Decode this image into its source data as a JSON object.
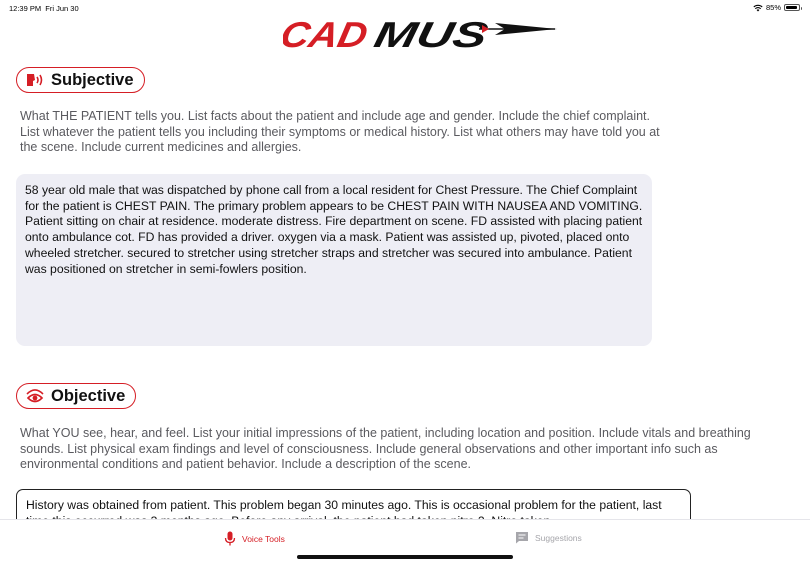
{
  "status_bar": {
    "time": "12:39 PM",
    "date": "Fri Jun 30",
    "battery": "85%"
  },
  "app": {
    "logo_text": "CADMUS"
  },
  "subjective": {
    "title": "Subjective",
    "instructions": "What THE PATIENT tells you. List facts about the patient and include age and gender. Include the chief complaint. List whatever the patient tells you including their symptoms or medical history. List what others may have told you at the scene. Include current medicines and allergies.",
    "narrative": "58 year old male that was dispatched by phone call from a local resident for Chest Pressure. The Chief Complaint for the patient is CHEST PAIN. The primary problem appears to be CHEST PAIN WITH NAUSEA AND VOMITING. Patient sitting on chair at residence. moderate distress. Fire department on scene. FD assisted with placing patient onto ambulance cot. FD has provided a driver. oxygen via a mask. Patient was assisted up, pivoted, placed onto wheeled stretcher. secured to stretcher using stretcher straps and stretcher was secured into ambulance. Patient was positioned on stretcher in semi-fowlers position."
  },
  "objective": {
    "title": "Objective",
    "instructions": "What YOU see, hear, and feel. List your initial impressions of the patient, including location and position. Include vitals and breathing sounds. List physical exam findings and level of consciousness. Include general observations and other important info such as environmental conditions and patient behavior. Include a description of the scene.",
    "narrative": "History was obtained from patient. This problem began 30 minutes ago. This is occasional problem for the patient, last time this occurred was 3 months ago. Before any arrival, the patient had taken nitro 2. Nitro taken"
  },
  "tabs": {
    "voice_tools": "Voice Tools",
    "suggestions": "Suggestions"
  },
  "colors": {
    "accent": "#d51e25",
    "text_box_bg": "#eeeef5"
  }
}
